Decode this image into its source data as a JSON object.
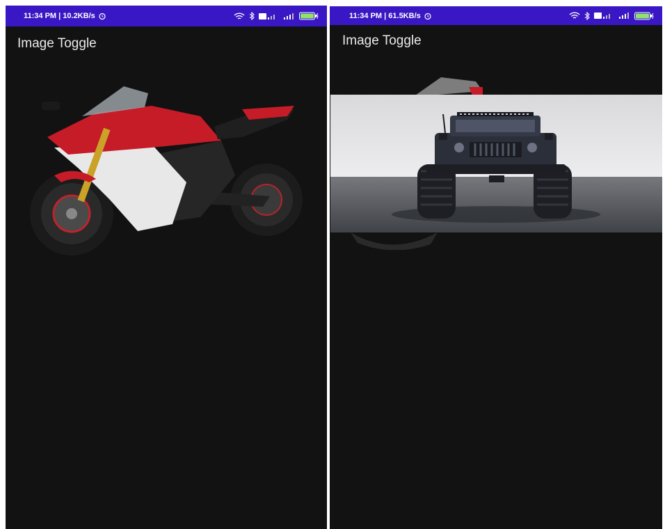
{
  "screens": [
    {
      "status": {
        "time": "11:34 PM | 10.2KB/s"
      },
      "app_title": "Image Toggle",
      "image": {
        "subject": "motorcycle",
        "alt_icon": "motorcycle-image"
      }
    },
    {
      "status": {
        "time": "11:34 PM | 61.5KB/s"
      },
      "app_title": "Image Toggle",
      "image": {
        "subject": "jeep",
        "alt_icon": "jeep-image"
      }
    }
  ],
  "colors": {
    "status_bar": "#3a17c4",
    "background": "#121212",
    "title_text": "#eaeaea"
  }
}
